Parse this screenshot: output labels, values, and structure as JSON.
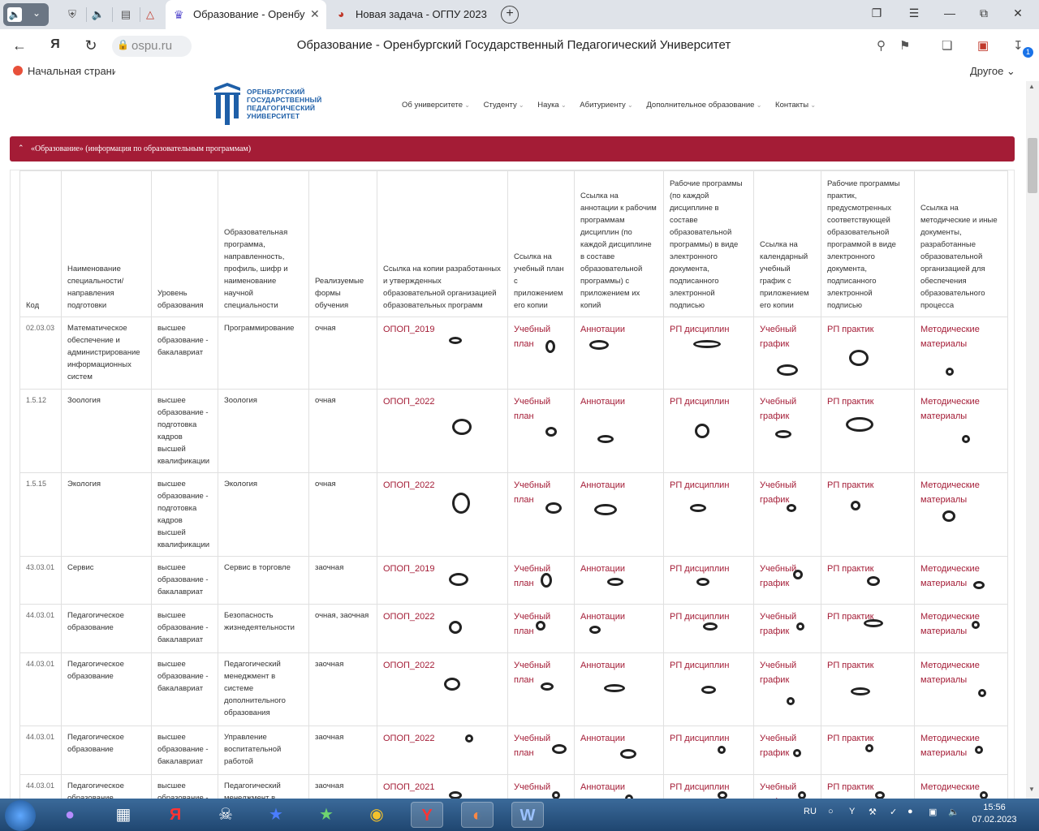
{
  "browser": {
    "active_tab_title": "Образование - Оренбург",
    "second_tab_title": "Новая задача - ОГПУ 2023",
    "url_host": "ospu.ru",
    "page_title": "Образование - Оренбургский Государственный Педагогический Университет",
    "bookmark_home": "Начальная страница",
    "bookmark_other": "Другое",
    "downloads_badge": "1"
  },
  "site": {
    "logo_lines": [
      "ОРЕНБУРГСКИЙ",
      "ГОСУДАРСТВЕННЫЙ",
      "ПЕДАГОГИЧЕСКИЙ",
      "УНИВЕРСИТЕТ"
    ],
    "nav": [
      "Об университете",
      "Студенту",
      "Наука",
      "Абитуриенту",
      "Дополнительное образование",
      "Контакты"
    ],
    "accordion_title": "«Образование» (информация по образовательным программам)"
  },
  "table": {
    "headers": [
      "Код",
      "Наименование специальности/ направления подготовки",
      "Уровень образования",
      "Образовательная программа, направленность, профиль, шифр и наименование научной специальности",
      "Реализуемые формы обучения",
      "Ссылка на копии разработанных и утвержденных образовательной организацией образовательных программ",
      "Ссылка на учебный план с приложением его копии",
      "Ссылка на аннотации к рабочим программам дисциплин (по каждой дисциплине в составе образовательной программы) с приложением их копий",
      "Рабочие программы (по каждой дисциплине в составе образовательной программы) в виде электронного документа, подписанного электронной подписью",
      "Ссылка на календарный учебный график с приложением его копии",
      "Рабочие программы практик, предусмотренных соответствующей образовательной программой в виде электронного документа, подписанного электронной подписью",
      "Ссылка на методические и иные документы, разработанные образовательной организацией для обеспечения образовательного процесса"
    ],
    "rows": [
      {
        "code": "02.03.03",
        "name": "Математическое обеспечение и администрирование информационных систем",
        "level": "высшее образование - бакалавриат",
        "program": "Программирование",
        "form": "очная",
        "opop": "ОПОП_2019"
      },
      {
        "code": "1.5.12",
        "name": "Зоология",
        "level": "высшее образование - подготовка кадров высшей квалификации",
        "program": "Зоология",
        "form": "очная",
        "opop": "ОПОП_2022"
      },
      {
        "code": "1.5.15",
        "name": "Экология",
        "level": "высшее образование - подготовка кадров высшей квалификации",
        "program": "Экология",
        "form": "очная",
        "opop": "ОПОП_2022"
      },
      {
        "code": "43.03.01",
        "name": "Сервис",
        "level": "высшее образование - бакалавриат",
        "program": "Сервис в торговле",
        "form": "заочная",
        "opop": "ОПОП_2019"
      },
      {
        "code": "44.03.01",
        "name": "Педагогическое образование",
        "level": "высшее образование - бакалавриат",
        "program": "Безопасность жизнедеятельности",
        "form": "очная, заочная",
        "opop": "ОПОП_2022"
      },
      {
        "code": "44.03.01",
        "name": "Педагогическое образование",
        "level": "высшее образование - бакалавриат",
        "program": "Педагогический менеджмент в системе дополнительного образования",
        "form": "заочная",
        "opop": "ОПОП_2022"
      },
      {
        "code": "44.03.01",
        "name": "Педагогическое образование",
        "level": "высшее образование - бакалавриат",
        "program": "Управление воспитательной работой",
        "form": "заочная",
        "opop": "ОПОП_2022"
      },
      {
        "code": "44.03.01",
        "name": "Педагогическое образование",
        "level": "высшее образование - бакалавриат",
        "program": "Педагогический менеджмент в системе",
        "form": "заочная",
        "opop": "ОПОП_2021"
      }
    ],
    "link_labels": {
      "plan": "Учебный план",
      "annot": "Аннотации",
      "rp": "РП дисциплин",
      "graph": "Учебный график",
      "practice": "РП практик",
      "method": "Методические материалы"
    }
  },
  "taskbar": {
    "lang": "RU",
    "time": "15:56",
    "date": "07.02.2023"
  }
}
